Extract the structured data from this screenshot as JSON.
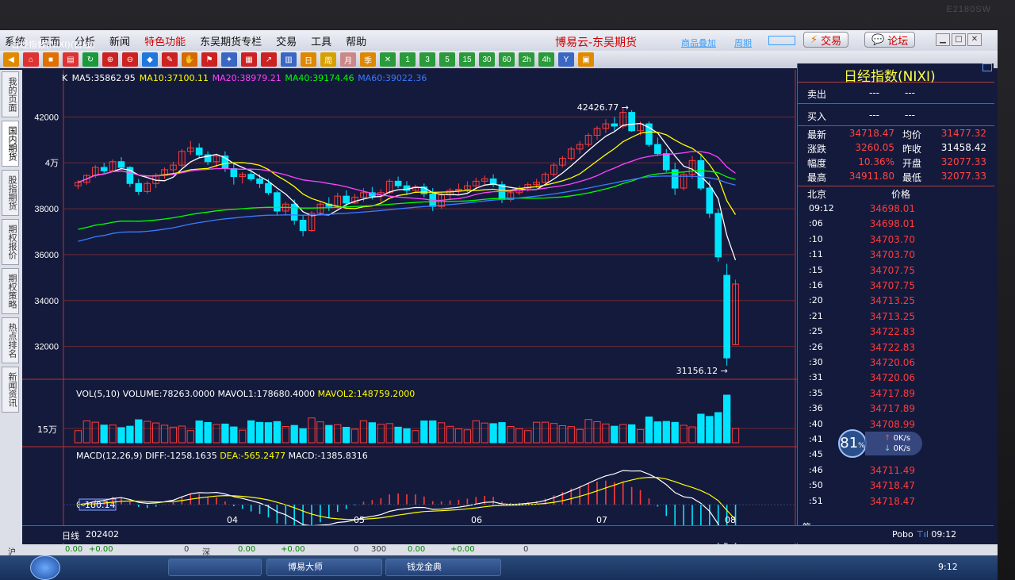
{
  "monitor_brand": "E2180SW",
  "menu": {
    "items": [
      "系统",
      "页面",
      "分析",
      "新闻",
      "特色功能",
      "东吴期货专栏",
      "交易",
      "工具",
      "帮助"
    ],
    "highlight_index": 4
  },
  "app_title": "博易云-东吴期货",
  "top_buttons": {
    "trade": "交易",
    "forum": "论坛"
  },
  "left_tabs": [
    "我的页面",
    "国内期货",
    "股指期货",
    "期权报价",
    "期权策略",
    "热点排名",
    "新闻资讯"
  ],
  "chart_header": {
    "title": "日经指数(NIXI)(日线)",
    "links": [
      "商品叠加",
      "周期"
    ]
  },
  "ma_legend": [
    {
      "label": "K",
      "color": "#ffffff"
    },
    {
      "label": "MA5:35862.95",
      "color": "#ffffff"
    },
    {
      "label": "MA10:37100.11",
      "color": "#ffff00"
    },
    {
      "label": "MA20:38979.21",
      "color": "#ff44ff"
    },
    {
      "label": "MA40:39174.46",
      "color": "#00ff00"
    },
    {
      "label": "MA60:39022.36",
      "color": "#3b7bff"
    }
  ],
  "price_axis": [
    "42000",
    "4万",
    "38000",
    "36000",
    "34000",
    "32000"
  ],
  "annotations": {
    "high": "42426.77",
    "low": "31156.12"
  },
  "vol_legend": {
    "a": "VOL(5,10)",
    "b": "VOLUME:78263.0000",
    "c": "MAVOL1:178680.4000",
    "d": "MAVOL2:148759.2000"
  },
  "vol_axis": "15万",
  "macd_legend": {
    "a": "MACD(12,26,9)",
    "b": "DIFF:-1258.1635",
    "c": "DEA:-565.2477",
    "d": "MACD:-1385.8316"
  },
  "macd_axis": {
    "zero": "0",
    "cursor_value": "-180.14"
  },
  "x_axis": {
    "period": "日线",
    "start": "202402",
    "months": [
      "04",
      "05",
      "06",
      "07",
      "08"
    ]
  },
  "quote": {
    "name": "日经指数(NIXI)",
    "sell_label": "卖出",
    "sell_a": "---",
    "sell_b": "---",
    "buy_label": "买入",
    "buy_a": "---",
    "buy_b": "---",
    "last_label": "最新",
    "last": "34718.47",
    "avg_label": "均价",
    "avg": "31477.32",
    "chg_label": "涨跌",
    "chg": "3260.05",
    "prev_label": "昨收",
    "prev": "31458.42",
    "amp_label": "幅度",
    "amp": "10.36%",
    "open_label": "开盘",
    "open": "32077.33",
    "high_label": "最高",
    "high": "34911.80",
    "low_label": "最低",
    "low": "32077.33",
    "time_header": "北京",
    "price_header": "价格"
  },
  "ticks": [
    {
      "t": "09:12",
      "p": "34698.01"
    },
    {
      "t": ":06",
      "p": "34698.01"
    },
    {
      "t": ":10",
      "p": "34703.70"
    },
    {
      "t": ":11",
      "p": "34703.70"
    },
    {
      "t": ":15",
      "p": "34707.75"
    },
    {
      "t": ":16",
      "p": "34707.75"
    },
    {
      "t": ":20",
      "p": "34713.25"
    },
    {
      "t": ":21",
      "p": "34713.25"
    },
    {
      "t": ":25",
      "p": "34722.83"
    },
    {
      "t": ":26",
      "p": "34722.83"
    },
    {
      "t": ":30",
      "p": "34720.06"
    },
    {
      "t": ":31",
      "p": "34720.06"
    },
    {
      "t": ":35",
      "p": "34717.89"
    },
    {
      "t": ":36",
      "p": "34717.89"
    },
    {
      "t": ":40",
      "p": "34708.99"
    },
    {
      "t": ":41",
      "p": ""
    },
    {
      "t": ":45",
      "p": ""
    },
    {
      "t": ":46",
      "p": "34711.49"
    },
    {
      "t": ":50",
      "p": "34718.47"
    },
    {
      "t": ":51",
      "p": "34718.47"
    }
  ],
  "net_widget": {
    "percent": "81",
    "unit": "%",
    "up": "0K/s",
    "down": "0K/s"
  },
  "bottom_stats": [
    "沪",
    "0.00",
    "+0.00",
    "0",
    "深",
    "0.00",
    "+0.00",
    "0",
    "300",
    "0.00",
    "+0.00",
    "0"
  ],
  "pobo": {
    "brand": "Pobo",
    "time": "09:12"
  },
  "taskbar": {
    "items": [
      "博易大师",
      "钱龙金典"
    ],
    "clock": "9:12"
  },
  "colors": {
    "up": "#ff3b3b",
    "down": "#00e5ff",
    "bg": "#141a3c",
    "grid": "#c03030"
  },
  "chart_data": {
    "type": "candlestick",
    "title": "日经指数(NIXI)(日线)",
    "ylim": [
      30500,
      43500
    ],
    "y_ticks": [
      32000,
      34000,
      36000,
      38000,
      40000,
      42000
    ],
    "x_months": [
      "04",
      "05",
      "06",
      "07",
      "08"
    ],
    "candles": [
      [
        39000,
        39250,
        38850,
        39150
      ],
      [
        39150,
        39500,
        39050,
        39450
      ],
      [
        39450,
        39900,
        39350,
        39800
      ],
      [
        39800,
        40000,
        39550,
        39650
      ],
      [
        39650,
        40150,
        39600,
        40050
      ],
      [
        40050,
        40250,
        39700,
        39800
      ],
      [
        39800,
        39850,
        38950,
        39100
      ],
      [
        39100,
        39300,
        38600,
        38750
      ],
      [
        38750,
        39200,
        38650,
        39100
      ],
      [
        39100,
        39550,
        38900,
        39450
      ],
      [
        39450,
        39800,
        39300,
        39700
      ],
      [
        39700,
        40050,
        39550,
        39900
      ],
      [
        39900,
        40600,
        39800,
        40500
      ],
      [
        40500,
        40950,
        40350,
        40650
      ],
      [
        40650,
        40850,
        40200,
        40350
      ],
      [
        40350,
        40500,
        39900,
        40050
      ],
      [
        40050,
        40400,
        39800,
        40300
      ],
      [
        40300,
        40500,
        39600,
        39750
      ],
      [
        39750,
        39950,
        39050,
        39400
      ],
      [
        39400,
        39600,
        39100,
        39500
      ],
      [
        39500,
        39700,
        39200,
        39300
      ],
      [
        39300,
        39500,
        38900,
        39100
      ],
      [
        39100,
        39300,
        38600,
        38700
      ],
      [
        38700,
        38800,
        37700,
        37900
      ],
      [
        37900,
        38300,
        37700,
        38200
      ],
      [
        38200,
        38400,
        37300,
        37500
      ],
      [
        37500,
        37700,
        36800,
        37050
      ],
      [
        37050,
        37900,
        37000,
        37800
      ],
      [
        37800,
        38300,
        37700,
        38200
      ],
      [
        38200,
        38500,
        37900,
        38100
      ],
      [
        38100,
        38700,
        38000,
        38550
      ],
      [
        38550,
        38800,
        38100,
        38250
      ],
      [
        38250,
        38650,
        38200,
        38500
      ],
      [
        38500,
        38900,
        38300,
        38700
      ],
      [
        38700,
        38950,
        38400,
        38550
      ],
      [
        38550,
        38850,
        38300,
        38700
      ],
      [
        38700,
        39300,
        38650,
        39200
      ],
      [
        39200,
        39400,
        38900,
        39000
      ],
      [
        39000,
        39200,
        38600,
        38800
      ],
      [
        38800,
        39050,
        38700,
        38950
      ],
      [
        38950,
        39100,
        38500,
        38650
      ],
      [
        38650,
        38900,
        37900,
        38100
      ],
      [
        38100,
        38700,
        38000,
        38600
      ],
      [
        38600,
        38900,
        38400,
        38800
      ],
      [
        38800,
        39100,
        38650,
        38850
      ],
      [
        38850,
        39200,
        38700,
        39000
      ],
      [
        39000,
        39350,
        38850,
        39200
      ],
      [
        39200,
        39450,
        39000,
        39300
      ],
      [
        39300,
        39500,
        38950,
        39050
      ],
      [
        39050,
        39200,
        38250,
        38400
      ],
      [
        38400,
        38800,
        38300,
        38700
      ],
      [
        38700,
        39000,
        38600,
        38900
      ],
      [
        38900,
        39150,
        38750,
        39050
      ],
      [
        39050,
        39300,
        38900,
        39150
      ],
      [
        39150,
        39600,
        39100,
        39500
      ],
      [
        39500,
        40000,
        39400,
        39900
      ],
      [
        39900,
        40300,
        39800,
        40200
      ],
      [
        40200,
        40700,
        40100,
        40600
      ],
      [
        40600,
        40950,
        40400,
        40800
      ],
      [
        40800,
        41300,
        40700,
        41200
      ],
      [
        41200,
        41600,
        41000,
        41500
      ],
      [
        41500,
        41900,
        41300,
        41700
      ],
      [
        41700,
        42000,
        41400,
        41600
      ],
      [
        41600,
        42426.77,
        41500,
        42200
      ],
      [
        42200,
        42300,
        41350,
        41400
      ],
      [
        41400,
        41800,
        41200,
        41700
      ],
      [
        41700,
        41800,
        40700,
        40800
      ],
      [
        40800,
        41100,
        40300,
        40400
      ],
      [
        40400,
        40600,
        39600,
        39700
      ],
      [
        39700,
        40000,
        38600,
        38900
      ],
      [
        38900,
        39600,
        38800,
        39500
      ],
      [
        39500,
        40300,
        39300,
        40100
      ],
      [
        40100,
        40400,
        38800,
        38900
      ],
      [
        38900,
        39200,
        37600,
        37800
      ],
      [
        37800,
        38000,
        35700,
        35900
      ],
      [
        35100,
        35600,
        31156.12,
        31500
      ],
      [
        32077.33,
        34911.8,
        32077.33,
        34718.47
      ]
    ],
    "ma_lines": [
      "MA5",
      "MA10",
      "MA20",
      "MA40",
      "MA60"
    ]
  }
}
